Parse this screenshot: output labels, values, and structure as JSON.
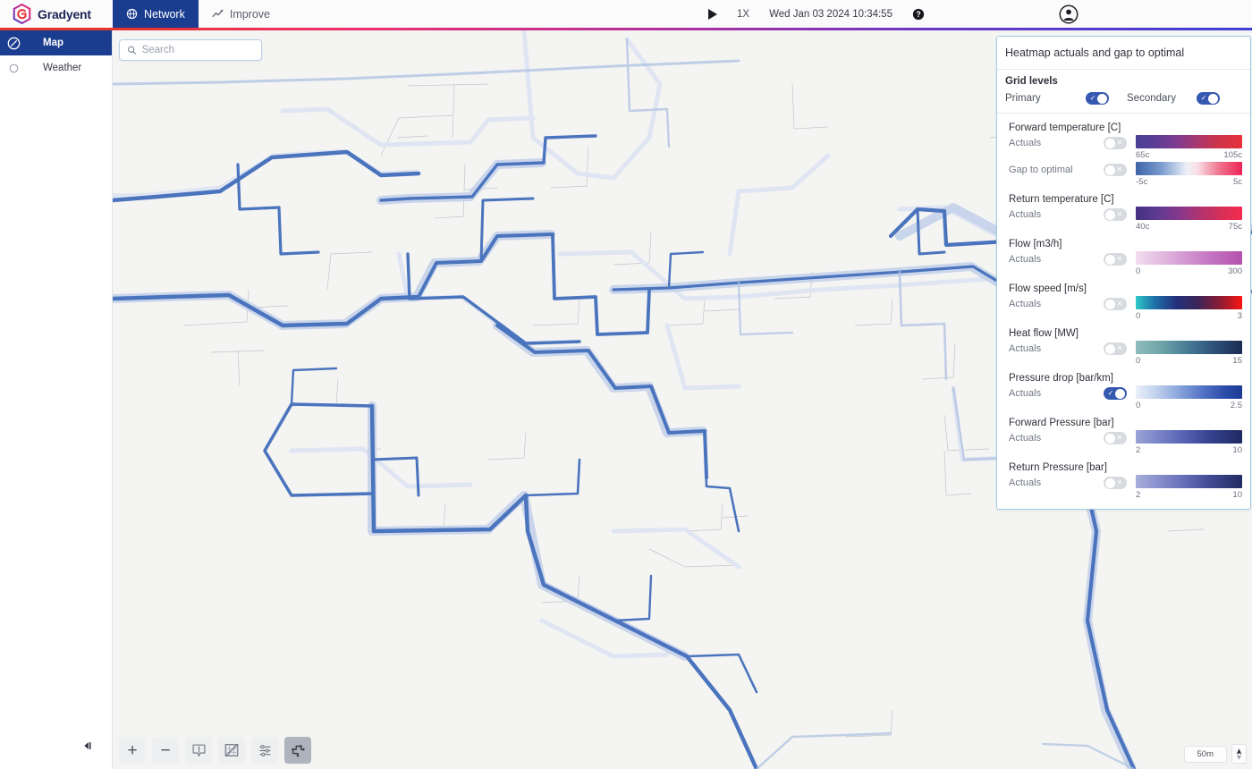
{
  "app": {
    "brand_name": "Gradyent",
    "brand_logo_icon": "gradyent-hexagon-logo"
  },
  "topbar": {
    "tabs": [
      {
        "label": "Network",
        "icon": "globe-icon",
        "active": true
      },
      {
        "label": "Improve",
        "icon": "line-chart-icon",
        "active": false
      }
    ],
    "play_icon": "play-icon",
    "speed": "1X",
    "clock": "Wed Jan 03 2024 10:34:55",
    "help_icon": "help-circle-icon",
    "avatar_icon": "user-avatar-icon"
  },
  "sidebar": {
    "items": [
      {
        "label": "Map",
        "icon": "compass-icon",
        "active": true
      },
      {
        "label": "Weather",
        "icon": "circle-outline-icon",
        "active": false
      }
    ],
    "collapse_icon": "collapse-left-icon"
  },
  "map": {
    "search": {
      "placeholder": "Search",
      "value": "",
      "icon": "search-icon"
    },
    "toolbar": [
      {
        "name": "zoom-in-button",
        "glyph": "+"
      },
      {
        "name": "zoom-out-button",
        "glyph": "−"
      },
      {
        "name": "alert-marker-button",
        "glyph": ""
      },
      {
        "name": "map-layers-button",
        "glyph": ""
      },
      {
        "name": "map-settings-button",
        "glyph": ""
      },
      {
        "name": "heatmap-toggle-button",
        "glyph": "",
        "active": true
      }
    ],
    "scale_label": "50m",
    "compass_icon": "compass-needle-icon",
    "background_color": "#f4f4f2",
    "pipe_color": "#4a74bd"
  },
  "panel": {
    "title": "Heatmap actuals and gap to optimal",
    "grid_levels": {
      "title": "Grid levels",
      "primary_label": "Primary",
      "primary_on": true,
      "secondary_label": "Secondary",
      "secondary_on": true
    },
    "actuals_label": "Actuals",
    "gap_label": "Gap to optimal",
    "metrics": [
      {
        "name": "Forward temperature [C]",
        "rows": [
          {
            "label": "Actuals",
            "on": false,
            "min": "65c",
            "max": "105c",
            "gradient": "linear-gradient(90deg,#4a3f96 0%,#5b3f96 18%,#7e3b90 38%,#a8386f 58%,#cd3448 78%,#e8323c 100%)"
          },
          {
            "label": "Gap to optimal",
            "on": false,
            "min": "-5c",
            "max": "5c",
            "gradient": "linear-gradient(90deg,#3d63a8 0%,#7e9fd0 25%,#eef1f6 48%,#fadfe6 58%,#f0768f 78%,#ec2356 100%)"
          }
        ]
      },
      {
        "name": "Return temperature [C]",
        "rows": [
          {
            "label": "Actuals",
            "on": false,
            "min": "40c",
            "max": "75c",
            "gradient": "linear-gradient(90deg,#43307e 0%,#5a3a90 18%,#84388c 40%,#b03370 60%,#d92f55 82%,#f42a4f 100%)"
          }
        ]
      },
      {
        "name": "Flow [m3/h]",
        "rows": [
          {
            "label": "Actuals",
            "on": false,
            "min": "0",
            "max": "300",
            "gradient": "linear-gradient(90deg,#f2ddef 0%,#e3bde0 22%,#d49ad3 45%,#c475c2 70%,#b451ac 100%)"
          }
        ]
      },
      {
        "name": "Flow speed [m/s]",
        "rows": [
          {
            "label": "Actuals",
            "on": false,
            "min": "0",
            "max": "3",
            "gradient": "linear-gradient(90deg,#2ec8c8 0%,#1f6fa8 18%,#22307c 38%,#3c2558 58%,#8f1b32 80%,#fa1512 100%)"
          }
        ]
      },
      {
        "name": "Heat flow [MW]",
        "rows": [
          {
            "label": "Actuals",
            "on": false,
            "min": "0",
            "max": "15",
            "gradient": "linear-gradient(90deg,#8fbcbb 0%,#6ba3a8 25%,#3f7190 55%,#2a4a73 78%,#1b2c52 100%)"
          }
        ]
      },
      {
        "name": "Pressure drop [bar/km]",
        "rows": [
          {
            "label": "Actuals",
            "on": true,
            "min": "0",
            "max": "2.5",
            "gradient": "linear-gradient(90deg,#eaf0fa 0%,#c4d3ee 18%,#8aa6dc 40%,#4f6ec4 65%,#2a4aa8 85%,#1f3c94 100%)"
          }
        ]
      },
      {
        "name": "Forward Pressure [bar]",
        "rows": [
          {
            "label": "Actuals",
            "on": false,
            "min": "2",
            "max": "10",
            "gradient": "linear-gradient(90deg,#9aa3d4 0%,#7b86c8 20%,#5763b4 45%,#36428f 70%,#1f2a60 100%)"
          }
        ]
      },
      {
        "name": "Return Pressure [bar]",
        "rows": [
          {
            "label": "Actuals",
            "on": false,
            "min": "2",
            "max": "10",
            "gradient": "linear-gradient(90deg,#a8aedb 0%,#8b92ce 20%,#666fb8 45%,#404a92 70%,#232c62 100%)"
          }
        ]
      }
    ]
  }
}
